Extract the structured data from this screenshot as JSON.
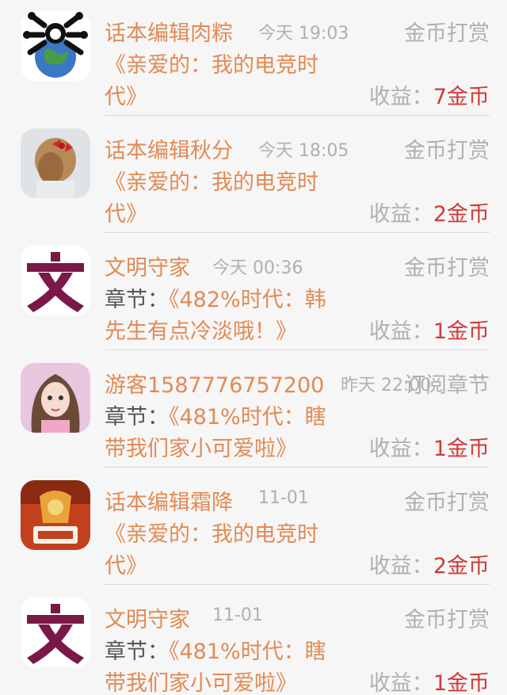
{
  "rows": [
    {
      "name": "话本编辑肉粽",
      "time": "今天 19:03",
      "action": "金币打赏",
      "prefix": "",
      "title1": "《亲爱的：我的电竞时",
      "title2": "代》",
      "earn_label": "收益：",
      "earn_value": "7金币",
      "avatar_icon": "bear-earth-avatar"
    },
    {
      "name": "话本编辑秋分",
      "time": "今天 18:05",
      "action": "金币打赏",
      "prefix": "",
      "title1": "《亲爱的：我的电竞时",
      "title2": "代》",
      "earn_label": "收益：",
      "earn_value": "2金币",
      "avatar_icon": "hair-bow-avatar"
    },
    {
      "name": "文明守家",
      "time": "今天 00:36",
      "action": "金币打赏",
      "prefix": "章节：",
      "title1": "《482%时代：韩",
      "title2": "先生有点冷淡哦！》",
      "earn_label": "收益：",
      "earn_value": "1金币",
      "avatar_icon": "wen-character-avatar"
    },
    {
      "name": "游客1587776757200",
      "time": "昨天 22:00",
      "action": "订阅章节",
      "prefix": "章节：",
      "title1": "《481%时代：瞎",
      "title2": "带我们家小可爱啦》",
      "earn_label": "收益：",
      "earn_value": "1金币",
      "avatar_icon": "cartoon-girl-avatar"
    },
    {
      "name": "话本编辑霜降",
      "time": "11-01",
      "action": "金币打赏",
      "prefix": "",
      "title1": "《亲爱的：我的电竞时",
      "title2": "代》",
      "earn_label": "收益：",
      "earn_value": "2金币",
      "avatar_icon": "plush-sign-avatar"
    },
    {
      "name": "文明守家",
      "time": "11-01",
      "action": "金币打赏",
      "prefix": "章节：",
      "title1": "《481%时代：瞎",
      "title2": "带我们家小可爱啦》",
      "earn_label": "收益：",
      "earn_value": "1金币",
      "avatar_icon": "wen-character-avatar"
    }
  ],
  "colors": {
    "name": "#e28a54",
    "muted": "#b0b0b0",
    "earn_value": "#d03a3a",
    "wen_background": "#7a1848"
  }
}
